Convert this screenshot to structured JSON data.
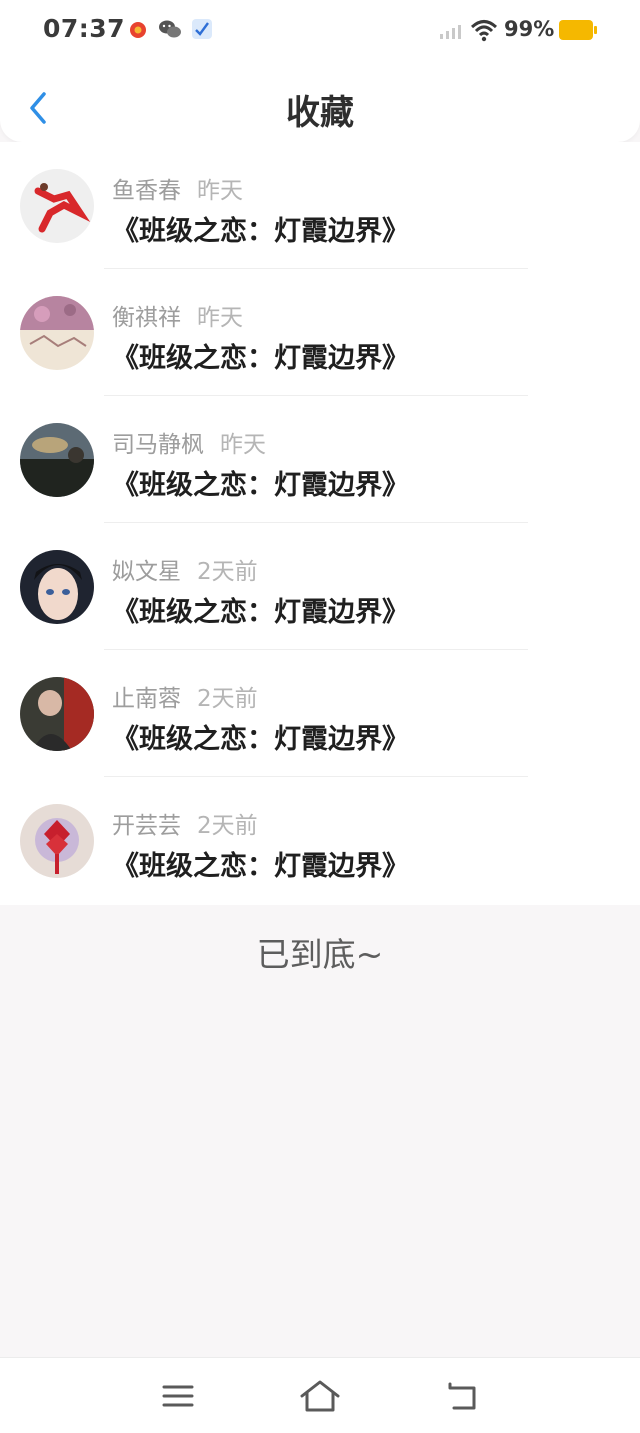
{
  "status_bar": {
    "time": "07:37",
    "battery": "99%",
    "icons": [
      "weibo-icon",
      "wechat-icon",
      "check-app-icon",
      "signal-icon",
      "wifi-icon",
      "battery-icon"
    ]
  },
  "header": {
    "title": "收藏",
    "back_icon": "chevron-left-icon"
  },
  "favorites": [
    {
      "user": "鱼香春",
      "time": "昨天",
      "book": "《班级之恋：灯霞边界》"
    },
    {
      "user": "衡祺祥",
      "time": "昨天",
      "book": "《班级之恋：灯霞边界》"
    },
    {
      "user": "司马静枫",
      "time": "昨天",
      "book": "《班级之恋：灯霞边界》"
    },
    {
      "user": "姒文星",
      "time": "2天前",
      "book": "《班级之恋：灯霞边界》"
    },
    {
      "user": "止南蓉",
      "time": "2天前",
      "book": "《班级之恋：灯霞边界》"
    },
    {
      "user": "开芸芸",
      "time": "2天前",
      "book": "《班级之恋：灯霞边界》"
    }
  ],
  "footer": {
    "end_text": "已到底~"
  },
  "nav": {
    "icons": [
      "menu-icon",
      "home-icon",
      "back-icon"
    ]
  },
  "colors": {
    "accent": "#2f8fe6",
    "battery": "#f5b800",
    "background": "#f8f6f7"
  }
}
